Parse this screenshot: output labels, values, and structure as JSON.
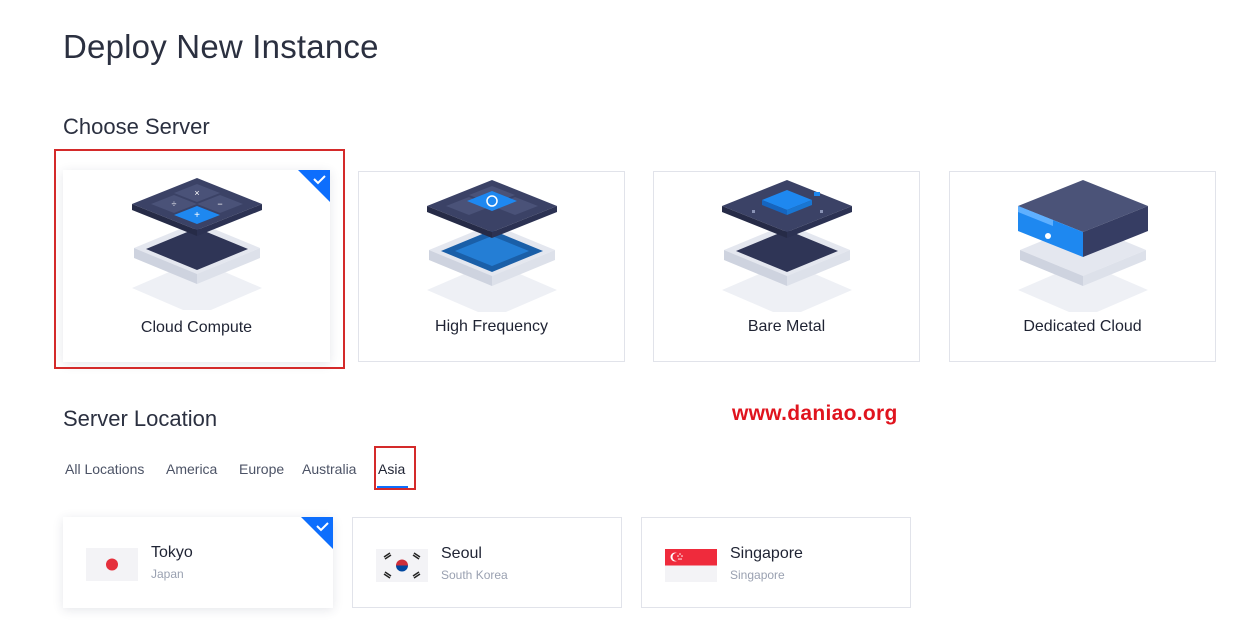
{
  "page": {
    "title": "Deploy New Instance"
  },
  "choose_server": {
    "title": "Choose Server",
    "options": [
      {
        "label": "Cloud Compute",
        "selected": true
      },
      {
        "label": "High Frequency",
        "selected": false
      },
      {
        "label": "Bare Metal",
        "selected": false
      },
      {
        "label": "Dedicated Cloud",
        "selected": false
      }
    ]
  },
  "watermark": "www.daniao.org",
  "server_location": {
    "title": "Server Location",
    "tabs": [
      "All Locations",
      "America",
      "Europe",
      "Australia",
      "Asia"
    ],
    "active_tab": "Asia",
    "locations": [
      {
        "city": "Tokyo",
        "country": "Japan",
        "selected": true
      },
      {
        "city": "Seoul",
        "country": "South Korea",
        "selected": false
      },
      {
        "city": "Singapore",
        "country": "Singapore",
        "selected": false
      }
    ]
  },
  "colors": {
    "accent": "#0d6efd",
    "highlight": "#d42a2a",
    "watermark": "#e0141e",
    "navy": "#2f3556"
  },
  "icons": [
    "checkmark-icon",
    "japan-flag-icon",
    "south-korea-flag-icon",
    "singapore-flag-icon"
  ]
}
